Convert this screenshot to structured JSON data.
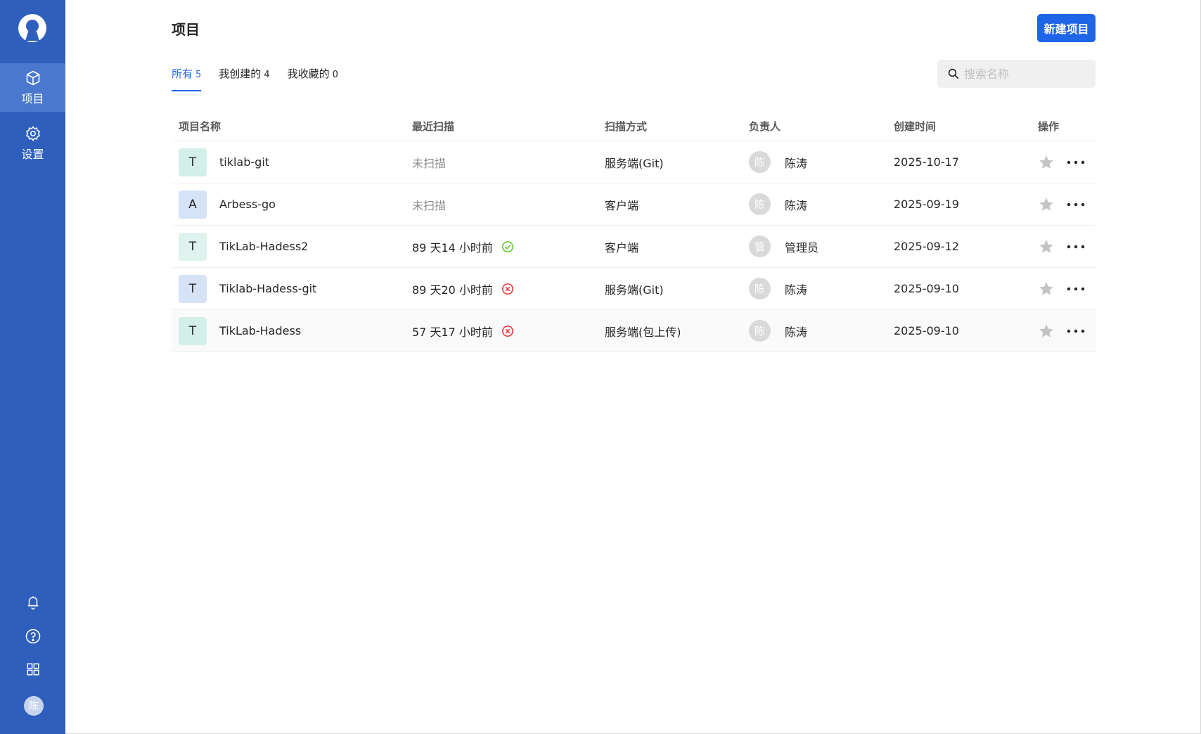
{
  "sidebar": {
    "nav": [
      {
        "label": "项目",
        "icon": "cube-icon",
        "active": true
      },
      {
        "label": "设置",
        "icon": "gear-icon",
        "active": false
      }
    ],
    "bottom_icons": [
      "bell-icon",
      "help-icon",
      "apps-grid-icon"
    ],
    "avatar_text": "陈"
  },
  "header": {
    "title": "项目",
    "new_button_label": "新建项目"
  },
  "tabs": [
    {
      "label": "所有",
      "count": "5",
      "active": true
    },
    {
      "label": "我创建的",
      "count": "4",
      "active": false
    },
    {
      "label": "我收藏的",
      "count": "0",
      "active": false
    }
  ],
  "search": {
    "placeholder": "搜索名称",
    "value": ""
  },
  "table": {
    "columns": [
      "项目名称",
      "最近扫描",
      "扫描方式",
      "负责人",
      "创建时间",
      "操作"
    ],
    "rows": [
      {
        "icon_letter": "T",
        "icon_color": "#d3efe9",
        "name": "tiklab-git",
        "last_scan": "未扫描",
        "scan_status": "none",
        "scan_way": "服务端(Git)",
        "owner_avatar": "陈",
        "owner": "陈涛",
        "created": "2025-10-17"
      },
      {
        "icon_letter": "A",
        "icon_color": "#d6e2f5",
        "name": "Arbess-go",
        "last_scan": "未扫描",
        "scan_status": "none",
        "scan_way": "客户端",
        "owner_avatar": "陈",
        "owner": "陈涛",
        "created": "2025-09-19"
      },
      {
        "icon_letter": "T",
        "icon_color": "#def2ee",
        "name": "TikLab-Hadess2",
        "last_scan": "89 天14 小时前",
        "scan_status": "success",
        "scan_way": "客户端",
        "owner_avatar": "管",
        "owner": "管理员",
        "created": "2025-09-12"
      },
      {
        "icon_letter": "T",
        "icon_color": "#d6e2f5",
        "name": "Tiklab-Hadess-git",
        "last_scan": "89 天20 小时前",
        "scan_status": "fail",
        "scan_way": "服务端(Git)",
        "owner_avatar": "陈",
        "owner": "陈涛",
        "created": "2025-09-10"
      },
      {
        "icon_letter": "T",
        "icon_color": "#d3efe9",
        "name": "TikLab-Hadess",
        "last_scan": "57 天17 小时前",
        "scan_status": "fail",
        "scan_way": "服务端(包上传)",
        "owner_avatar": "陈",
        "owner": "陈涛",
        "created": "2025-09-10"
      }
    ]
  },
  "colors": {
    "sidebar": "#2e5fbd",
    "sidebar_active": "#4a78cf",
    "primary": "#1f65e8",
    "success": "#52c41a",
    "error": "#f5222d"
  }
}
